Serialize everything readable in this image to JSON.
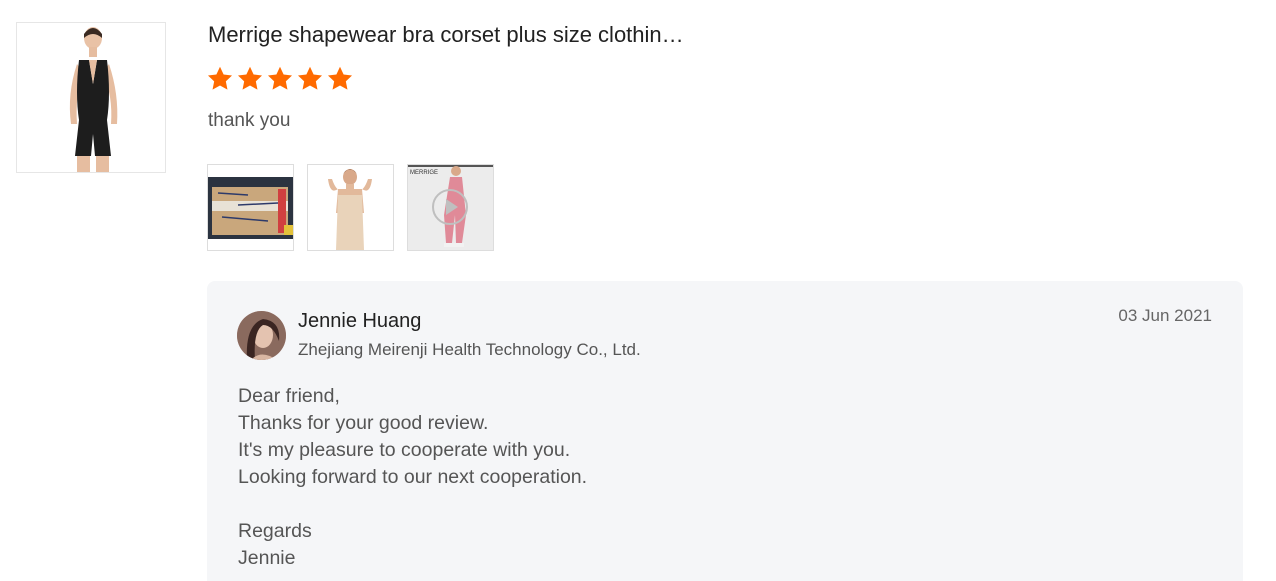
{
  "review": {
    "product_title": "Merrige shapewear bra corset plus size clothin…",
    "rating": 5,
    "rating_max": 5,
    "text": "thank you",
    "photos": [
      {
        "icon": "package-box-photo",
        "is_video": false
      },
      {
        "icon": "shapewear-model-photo",
        "is_video": false
      },
      {
        "icon": "leggings-video-thumbnail",
        "is_video": true,
        "watermark": "MERRIGE"
      }
    ]
  },
  "reply": {
    "seller_name": "Jennie Huang",
    "company": "Zhejiang Meirenji Health Technology Co., Ltd.",
    "date": "03 Jun 2021",
    "lines": [
      "Dear friend,",
      "Thanks for your good review.",
      "It's my pleasure to cooperate with you.",
      "Looking forward to our next cooperation.",
      "",
      "Regards",
      "Jennie"
    ]
  },
  "colors": {
    "star": "#ff6a00",
    "card_bg": "#f5f6f8"
  }
}
